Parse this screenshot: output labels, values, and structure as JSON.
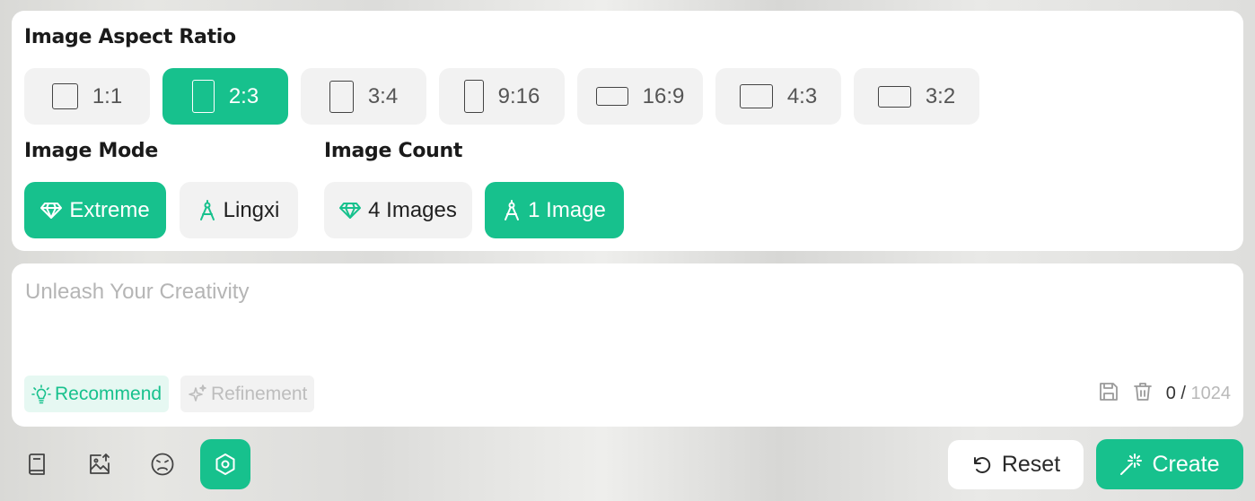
{
  "aspect_ratio": {
    "title": "Image Aspect Ratio",
    "options": [
      {
        "label": "1:1",
        "selected": false
      },
      {
        "label": "2:3",
        "selected": true
      },
      {
        "label": "3:4",
        "selected": false
      },
      {
        "label": "9:16",
        "selected": false
      },
      {
        "label": "16:9",
        "selected": false
      },
      {
        "label": "4:3",
        "selected": false
      },
      {
        "label": "3:2",
        "selected": false
      }
    ]
  },
  "image_mode": {
    "title": "Image Mode",
    "options": [
      {
        "label": "Extreme",
        "icon": "diamond-icon",
        "selected": true
      },
      {
        "label": "Lingxi",
        "icon": "compass-icon",
        "selected": false
      }
    ]
  },
  "image_count": {
    "title": "Image Count",
    "options": [
      {
        "label": "4 Images",
        "icon": "diamond-icon",
        "selected": false
      },
      {
        "label": "1 Image",
        "icon": "compass-icon",
        "selected": true
      }
    ]
  },
  "prompt": {
    "placeholder": "Unleash Your Creativity",
    "recommend_label": "Recommend",
    "refinement_label": "Refinement",
    "char_count": "0",
    "separator": "/",
    "char_limit": "1024"
  },
  "toolbar": {
    "tools": [
      "book-icon",
      "image-upload-icon",
      "emoji-icon",
      "settings-hexagon-icon"
    ],
    "active_tool": "settings-hexagon-icon",
    "reset_label": "Reset",
    "create_label": "Create"
  },
  "colors": {
    "accent": "#17c18d",
    "accent_light": "#e6f8f2",
    "chip_bg": "#f2f2f2"
  }
}
